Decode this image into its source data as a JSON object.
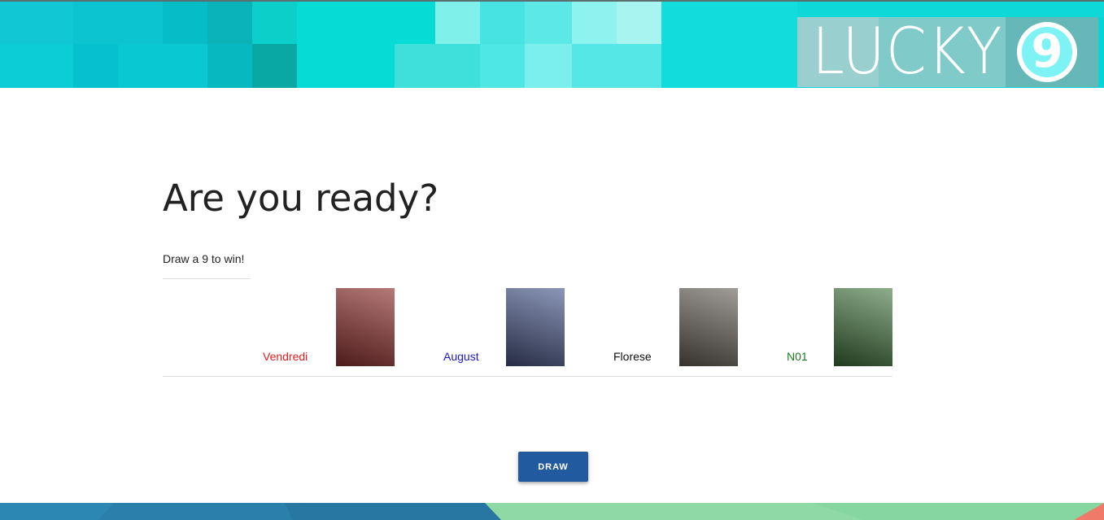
{
  "header": {
    "logo_text": "LUCKY",
    "logo_digit": "9"
  },
  "main": {
    "heading": "Are you ready?",
    "subtitle": "Draw a 9 to win!"
  },
  "players": [
    {
      "name": "Vendredi",
      "color": "#e02020",
      "card_colors": [
        "#b47a78",
        "#4e1a1a"
      ]
    },
    {
      "name": "August",
      "color": "#1a1ad0",
      "card_colors": [
        "#8c97b8",
        "#262c44"
      ]
    },
    {
      "name": "Florese",
      "color": "#111111",
      "card_colors": [
        "#a09c96",
        "#35322e"
      ]
    },
    {
      "name": "N01",
      "color": "#1f7a1f",
      "card_colors": [
        "#8fae8c",
        "#1f3a1d"
      ]
    }
  ],
  "actions": {
    "draw_label": "DRAW"
  },
  "colors": {
    "banner": "#06d4d6",
    "button": "#225aa0",
    "footer_blue": "#2a7fab",
    "footer_green": "#8fd9a5"
  }
}
